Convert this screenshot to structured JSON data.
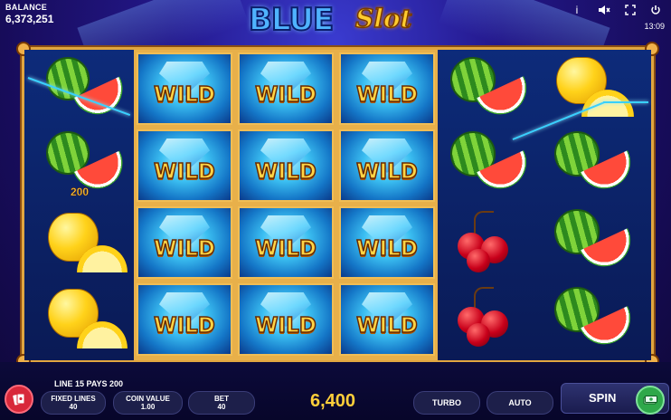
{
  "header": {
    "balance_label": "BALANCE",
    "balance_value": "6,373,251",
    "logo_blue": "BLUE",
    "logo_slot": "Slot",
    "clock": "13:09",
    "icons": [
      "info-icon",
      "sound-icon",
      "fullscreen-icon",
      "power-icon"
    ]
  },
  "reels": {
    "wild_label": "WILD",
    "reel1": [
      "watermelon",
      "watermelon",
      "lemon",
      "lemon"
    ],
    "reel2": [
      "wild",
      "wild",
      "wild",
      "wild"
    ],
    "reel3": [
      "wild",
      "wild",
      "wild",
      "wild"
    ],
    "reel4": [
      "wild",
      "wild",
      "wild",
      "wild"
    ],
    "reel5": [
      "watermelon",
      "watermelon",
      "cherry",
      "cherry"
    ],
    "reel6": [
      "lemon",
      "watermelon",
      "watermelon",
      "watermelon"
    ],
    "win_amount_on_reel": "200",
    "payline_color": "#39d0ff"
  },
  "footer": {
    "line_info": "LINE 15 PAYS 200",
    "fixed_lines_label": "FIXED LINES",
    "fixed_lines_value": "40",
    "coin_value_label": "COIN VALUE",
    "coin_value_value": "1.00",
    "bet_label": "BET",
    "bet_value": "40",
    "win_value": "6,400",
    "turbo_label": "TURBO",
    "auto_label": "AUTO",
    "spin_label": "SPIN"
  },
  "colors": {
    "frame_gold": "#e1a640",
    "win_yellow": "#ffcf3a",
    "spin_green": "#2ea84a"
  }
}
